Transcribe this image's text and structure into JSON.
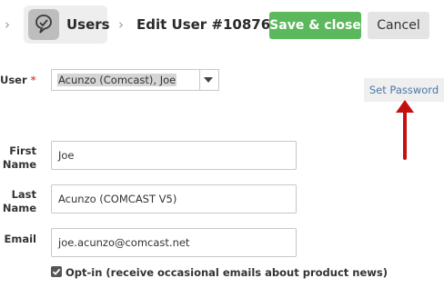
{
  "header": {
    "breadcrumb_section": "Users",
    "title": "Edit User #10876",
    "save_label": "Save & close",
    "cancel_label": "Cancel"
  },
  "form": {
    "user": {
      "label": "User",
      "required_mark": "*",
      "selected_value": "Acunzo (Comcast), Joe"
    },
    "set_password_label": "Set Password",
    "first_name": {
      "label_line1": "First",
      "label_line2": "Name",
      "value": "Joe"
    },
    "last_name": {
      "label_line1": "Last",
      "label_line2": "Name",
      "value": "Acunzo (COMCAST V5)"
    },
    "email": {
      "label": "Email",
      "value": "joe.acunzo@comcast.net"
    },
    "opt_in": {
      "label": "Opt-in (receive occasional emails about product news)",
      "checked": true
    }
  },
  "colors": {
    "save_button": "#5cb85c",
    "required": "#d9534f",
    "link": "#4a77a8",
    "annotation_arrow": "#c41010"
  },
  "icons": {
    "users_module": "users-module-icon",
    "breadcrumb_separator": "chevron-right-icon",
    "select_arrow": "caret-down-icon"
  }
}
